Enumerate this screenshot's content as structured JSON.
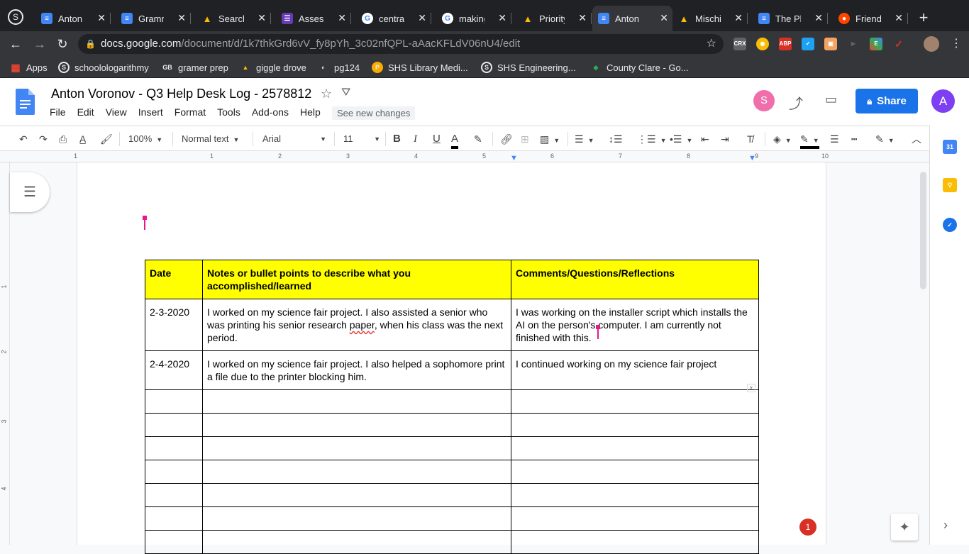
{
  "browser": {
    "tabs": [
      {
        "title": "Anton Vc",
        "icon": "docs-icon",
        "color": "#4285f4",
        "glyph": "≡",
        "active": false
      },
      {
        "title": "Gramma",
        "icon": "docs-icon",
        "color": "#4285f4",
        "glyph": "≡",
        "active": false
      },
      {
        "title": "Search r",
        "icon": "drive-icon",
        "color": "#fbbc04",
        "glyph": "▲",
        "active": false
      },
      {
        "title": "Assessm",
        "icon": "forms-icon",
        "color": "#673ab7",
        "glyph": "☰",
        "active": false
      },
      {
        "title": "central a",
        "icon": "google-icon",
        "color": "#ffffff",
        "glyph": "G",
        "active": false
      },
      {
        "title": "making j",
        "icon": "google-icon",
        "color": "#ffffff",
        "glyph": "G",
        "active": false
      },
      {
        "title": "Priority -",
        "icon": "drive-icon",
        "color": "#fbbc04",
        "glyph": "▲",
        "active": false
      },
      {
        "title": "Anton Vc",
        "icon": "docs-icon",
        "color": "#4285f4",
        "glyph": "≡",
        "active": true
      },
      {
        "title": "Mischief",
        "icon": "drive-icon",
        "color": "#fbbc04",
        "glyph": "▲",
        "active": false
      },
      {
        "title": "The Plan",
        "icon": "docs-icon",
        "color": "#4285f4",
        "glyph": "≡",
        "active": false
      },
      {
        "title": "Friend o",
        "icon": "reddit-icon",
        "color": "#ff4500",
        "glyph": "●",
        "active": false
      }
    ],
    "url_host": "docs.google.com",
    "url_path": "/document/d/1k7thkGrd6vV_fy8pYh_3c02nfQPL-aAacKFLdV06nU4/edit",
    "bookmarks": [
      {
        "label": "Apps",
        "icon": "apps-grid-icon"
      },
      {
        "label": "schoolologarithmy",
        "icon": "schoology-icon"
      },
      {
        "label": "gramer prep",
        "icon": "gb-icon"
      },
      {
        "label": "giggle drove",
        "icon": "drive-icon"
      },
      {
        "label": "pg124",
        "icon": "globe-icon"
      },
      {
        "label": "SHS Library Medi...",
        "icon": "library-icon"
      },
      {
        "label": "SHS Engineering...",
        "icon": "schoology-icon"
      },
      {
        "label": "County Clare - Go...",
        "icon": "maps-icon"
      }
    ]
  },
  "docs": {
    "title": "Anton Voronov - Q3 Help Desk Log - 2578812",
    "menu": [
      "File",
      "Edit",
      "View",
      "Insert",
      "Format",
      "Tools",
      "Add-ons",
      "Help"
    ],
    "see_changes": "See new changes",
    "avatar_s": "S",
    "avatar_a": "A",
    "share_label": "Share",
    "zoom": "100%",
    "style": "Normal text",
    "font": "Arial",
    "font_size": "11",
    "ruler_numbers": [
      "1",
      "1",
      "2",
      "3",
      "4",
      "5",
      "6",
      "7",
      "8",
      "9",
      "10"
    ],
    "vruler_numbers": [
      "1",
      "2",
      "3",
      "4"
    ],
    "notification_count": "1",
    "side_calendar": "31"
  },
  "table": {
    "headers": [
      "Date",
      "Notes or bullet points to describe what you accomplished/learned",
      "Comments/Questions/Reflections"
    ],
    "rows": [
      {
        "date": "2-3-2020",
        "notes_pre": "I worked on my science fair project. I also assisted a senior who was printing his senior research ",
        "notes_err": "paper",
        "notes_post": ", when his class was the next period.",
        "comments": "I was working on the installer script which installs the AI on the person's computer. I am currently not finished with this."
      },
      {
        "date": "2-4-2020",
        "notes_pre": "I worked on my science fair project. I also helped a sophomore print a file due to the printer blocking him.",
        "notes_err": "",
        "notes_post": "",
        "comments": "I continued working on my science fair project"
      }
    ],
    "empty_rows": 7
  }
}
